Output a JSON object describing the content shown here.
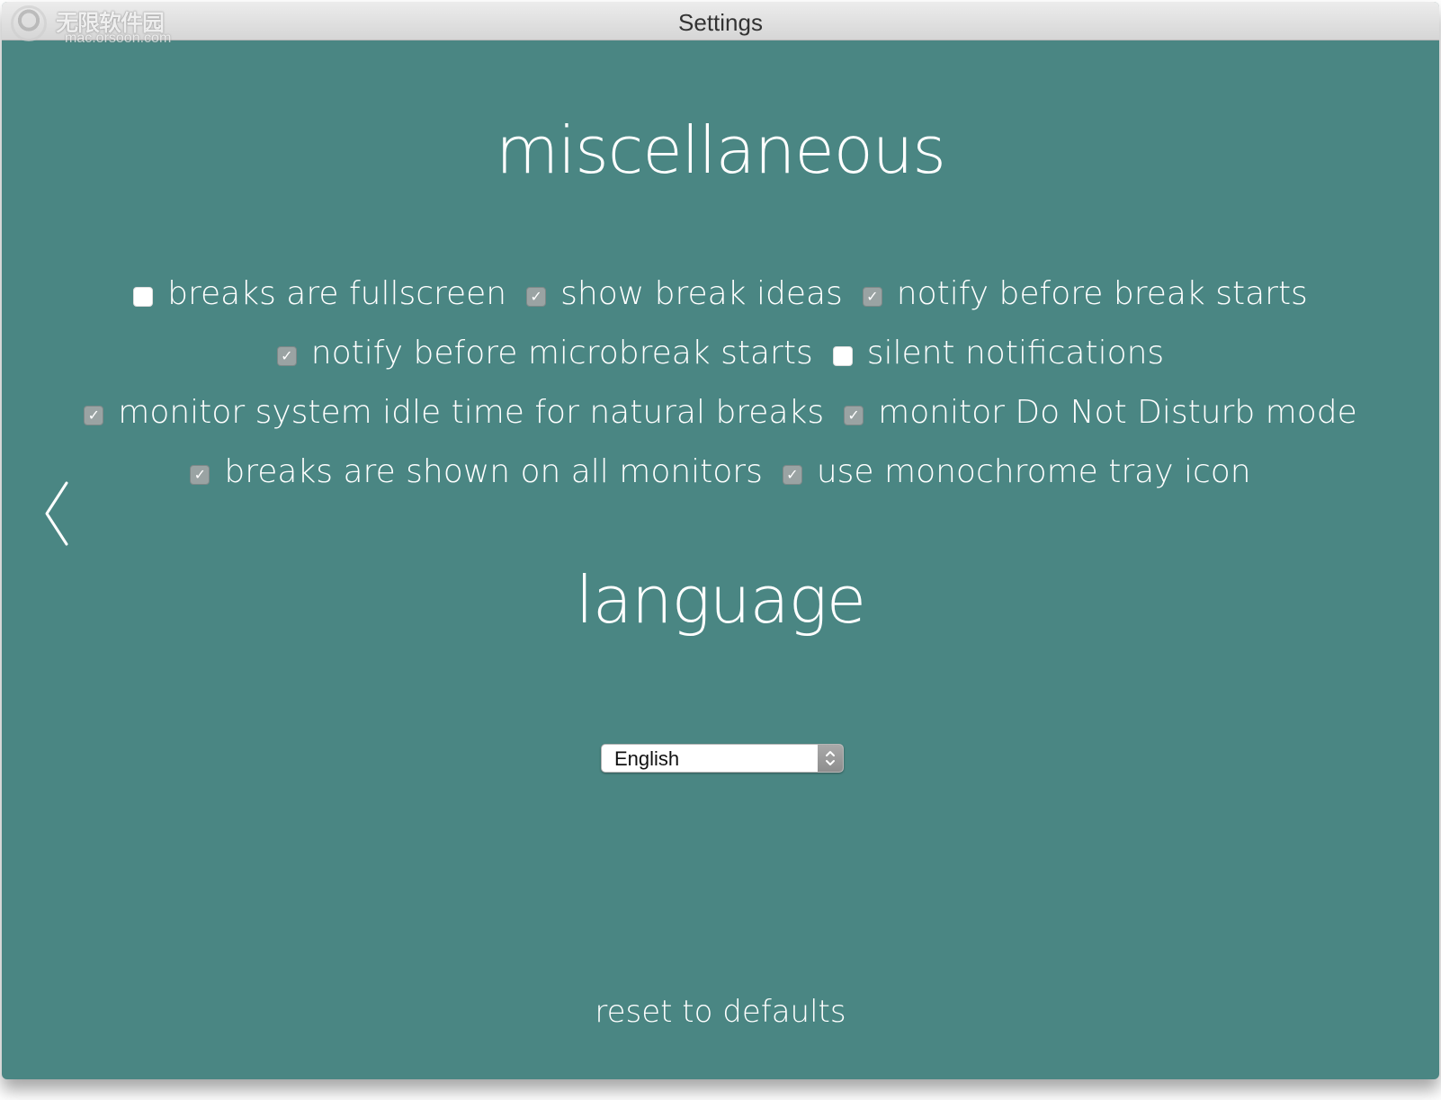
{
  "window": {
    "title": "Settings"
  },
  "watermark": {
    "brand_text": "无限软件园",
    "url": "mac.orsoon.com"
  },
  "sections": {
    "misc_title": "miscellaneous",
    "language_title": "language"
  },
  "options": {
    "rows": [
      [
        {
          "label": "breaks are fullscreen",
          "checked": false
        },
        {
          "label": "show break ideas",
          "checked": true
        },
        {
          "label": "notify before break starts",
          "checked": true
        }
      ],
      [
        {
          "label": "notify before microbreak starts",
          "checked": true
        },
        {
          "label": "silent notifications",
          "checked": false
        }
      ],
      [
        {
          "label": "monitor system idle time for natural breaks",
          "checked": true
        },
        {
          "label": "monitor Do Not Disturb mode",
          "checked": true
        }
      ],
      [
        {
          "label": "breaks are shown on all monitors",
          "checked": true
        },
        {
          "label": "use monochrome tray icon",
          "checked": true
        }
      ]
    ]
  },
  "language": {
    "selected": "English"
  },
  "footer": {
    "reset_label": "reset to defaults"
  },
  "colors": {
    "background": "#4a8683",
    "text": "#ffffff",
    "checkbox_on": "#9aa3a3",
    "checkbox_off": "#ffffff"
  },
  "icons": {
    "back": "chevron-left-icon",
    "check": "checkmark-icon",
    "select": "up-down-chevron-icon"
  }
}
